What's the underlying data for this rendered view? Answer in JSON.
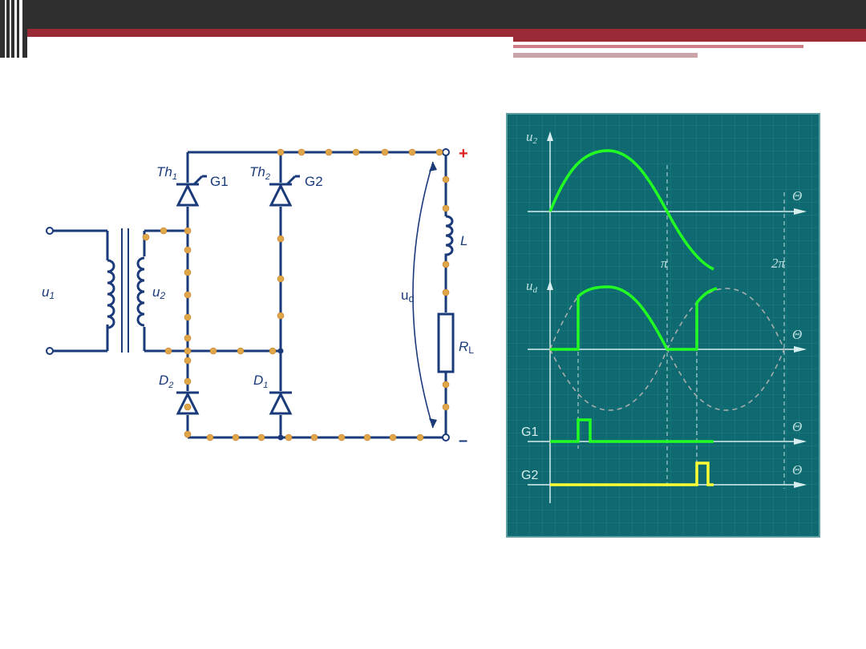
{
  "header": {
    "bar_color": "#2f2f2f",
    "accent_color": "#9a2a35"
  },
  "circuit": {
    "labels": {
      "th1": "Th",
      "th1_sub": "1",
      "g1": "G1",
      "th2": "Th",
      "th2_sub": "2",
      "g2": "G2",
      "u1": "u",
      "u1_sub": "1",
      "u2": "u",
      "u2_sub": "2",
      "d2": "D",
      "d2_sub": "2",
      "d1": "D",
      "d1_sub": "1",
      "ud": "u",
      "ud_sub": "d",
      "l": "L",
      "rl": "R",
      "rl_sub": "L",
      "plus": "+",
      "minus": "–"
    },
    "wire_color": "#1a3a7a",
    "dot_color": "#e0a64a"
  },
  "oscilloscope": {
    "background": "#0e6a70",
    "labels": {
      "u2": "u",
      "u2_sub": "2",
      "ud": "u",
      "ud_sub": "d",
      "g1": "G1",
      "g2": "G2",
      "theta": "Θ",
      "pi": "π",
      "two_pi": "2π"
    },
    "colors": {
      "wave": "#22ff22",
      "gate2": "#ffff33",
      "dashed": "#b0b0b0"
    }
  }
}
